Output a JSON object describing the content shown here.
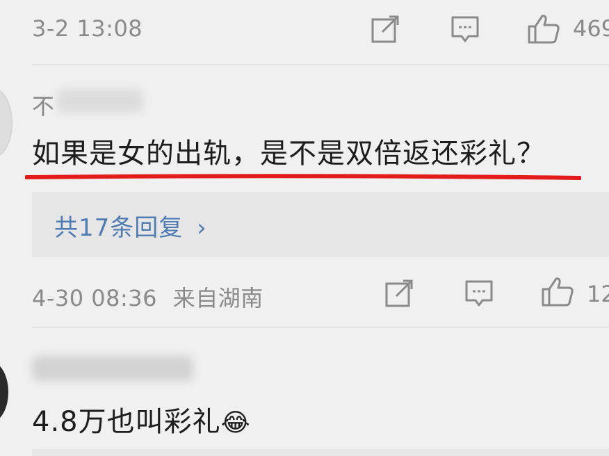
{
  "comments": [
    {
      "timestamp": "3-2 13:08",
      "like_count": "469",
      "actions": {
        "share_icon": "share-icon",
        "comment_icon": "comment-icon",
        "like_icon": "thumbs-up-icon"
      }
    },
    {
      "username_visible": "不",
      "text": "如果是女的出轨，是不是双倍返还彩礼？",
      "replies_label": "共17条回复",
      "replies_chevron": "›",
      "timestamp": "4-30 08:36",
      "location": "来自湖南",
      "like_count": "12",
      "highlight_color": "#e31b1b"
    },
    {
      "text": "4.8万也叫彩礼",
      "emoji": "😂"
    }
  ],
  "colors": {
    "background": "#f0f0f0",
    "meta_text": "#8a8a8a",
    "link": "#4e7bb1",
    "underline": "#e31b1b"
  }
}
